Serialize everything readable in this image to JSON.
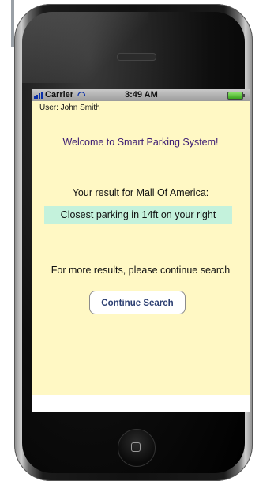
{
  "status_bar": {
    "carrier": "Carrier",
    "time": "3:49 AM"
  },
  "user": {
    "label": "User: John Smith"
  },
  "welcome": {
    "text": "Welcome to Smart Parking System!"
  },
  "result": {
    "label": "Your result for Mall Of America:",
    "message": "Closest parking in 14ft on your right"
  },
  "more_results": {
    "text": "For more results, please continue search"
  },
  "continue_button": {
    "label": "Continue Search"
  },
  "colors": {
    "screen_background": "#fff8c4",
    "result_highlight": "#c4f2dc",
    "welcome_text": "#3a1a73",
    "button_text": "#2c3f72"
  },
  "icons": [
    "signal-icon",
    "wifi-icon",
    "battery-icon",
    "home-button-icon"
  ]
}
